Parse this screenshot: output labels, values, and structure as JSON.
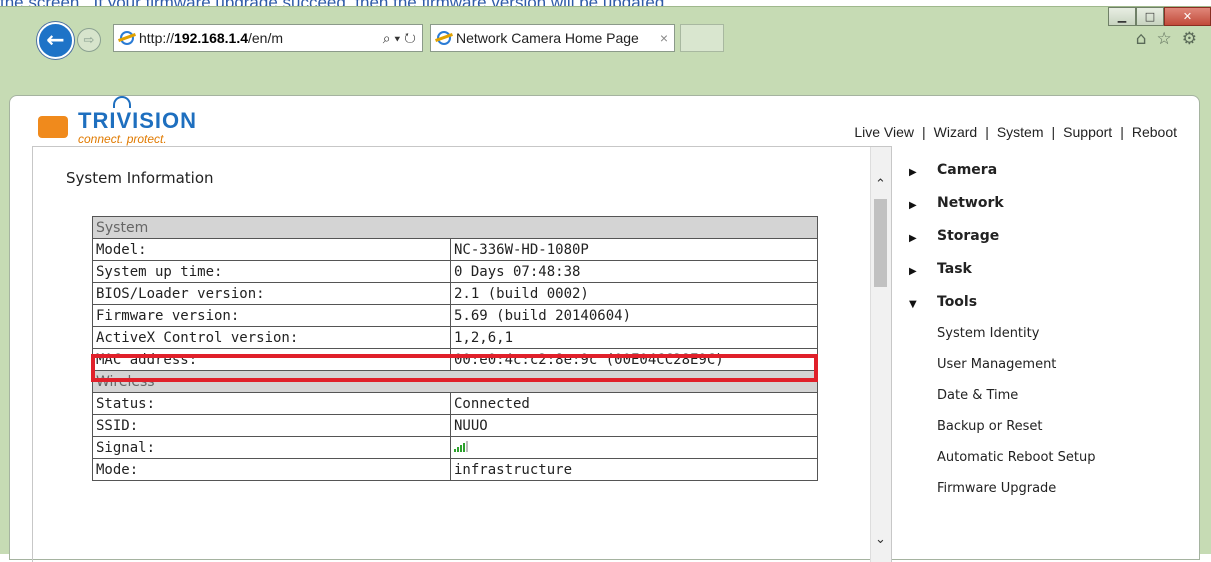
{
  "caption": "the screen . If your firmware upgrade succeed, then the firmware version will be updated.",
  "browser": {
    "address_prefix": "http://",
    "address_host": "192.168.1.4",
    "address_rest": "/en/m",
    "search_glyph": "⌕ ▾ ↻",
    "tab_title": "Network Camera Home Page",
    "tab_close": "×",
    "back_glyph": "←",
    "forward_glyph": "⇨",
    "home_glyph": "⌂",
    "star_glyph": "☆",
    "gear_glyph": "⚙",
    "min_glyph": "▁",
    "max_glyph": "□",
    "close_glyph": "✕"
  },
  "brand": {
    "name": "TRIVISION",
    "tagline": "connect. protect."
  },
  "top_nav": [
    "Live View",
    "Wizard",
    "System",
    "Support",
    "Reboot"
  ],
  "top_nav_sep": "|",
  "heading": "System Information",
  "scroll": {
    "up": "⌃",
    "down": "⌄"
  },
  "rows": [
    {
      "type": "section",
      "label": "System"
    },
    {
      "type": "row",
      "label": "Model:",
      "value": "NC-336W-HD-1080P"
    },
    {
      "type": "row",
      "label": "System up time:",
      "value": "0 Days 07:48:38"
    },
    {
      "type": "row",
      "label": "BIOS/Loader version:",
      "value": "2.1 (build 0002)"
    },
    {
      "type": "row",
      "label": "Firmware version:",
      "value": "5.69 (build 20140604)"
    },
    {
      "type": "row",
      "label": "ActiveX Control version:",
      "value": "1,2,6,1"
    },
    {
      "type": "row",
      "label": "MAC address:",
      "value": "00:e0:4c:c2:8e:9c (00E04CC28E9C)"
    },
    {
      "type": "section",
      "label": "Wireless"
    },
    {
      "type": "row",
      "label": "Status:",
      "value": "Connected"
    },
    {
      "type": "row",
      "label": "SSID:",
      "value": "NUUO"
    },
    {
      "type": "signal",
      "label": "Signal:",
      "value": ""
    },
    {
      "type": "row",
      "label": "Mode:",
      "value": "infrastructure"
    }
  ],
  "signal_level": 0.8,
  "side_menu": {
    "categories": [
      {
        "label": "Camera",
        "expanded": false
      },
      {
        "label": "Network",
        "expanded": false
      },
      {
        "label": "Storage",
        "expanded": false
      },
      {
        "label": "Task",
        "expanded": false
      },
      {
        "label": "Tools",
        "expanded": true
      }
    ],
    "tools_items": [
      "System Identity",
      "User Management",
      "Date & Time",
      "Backup or Reset",
      "Automatic Reboot Setup",
      "Firmware Upgrade"
    ]
  },
  "colors": {
    "highlight": "#e0202a",
    "brand_blue": "#1e6fbf",
    "brand_orange": "#f08a1c"
  }
}
